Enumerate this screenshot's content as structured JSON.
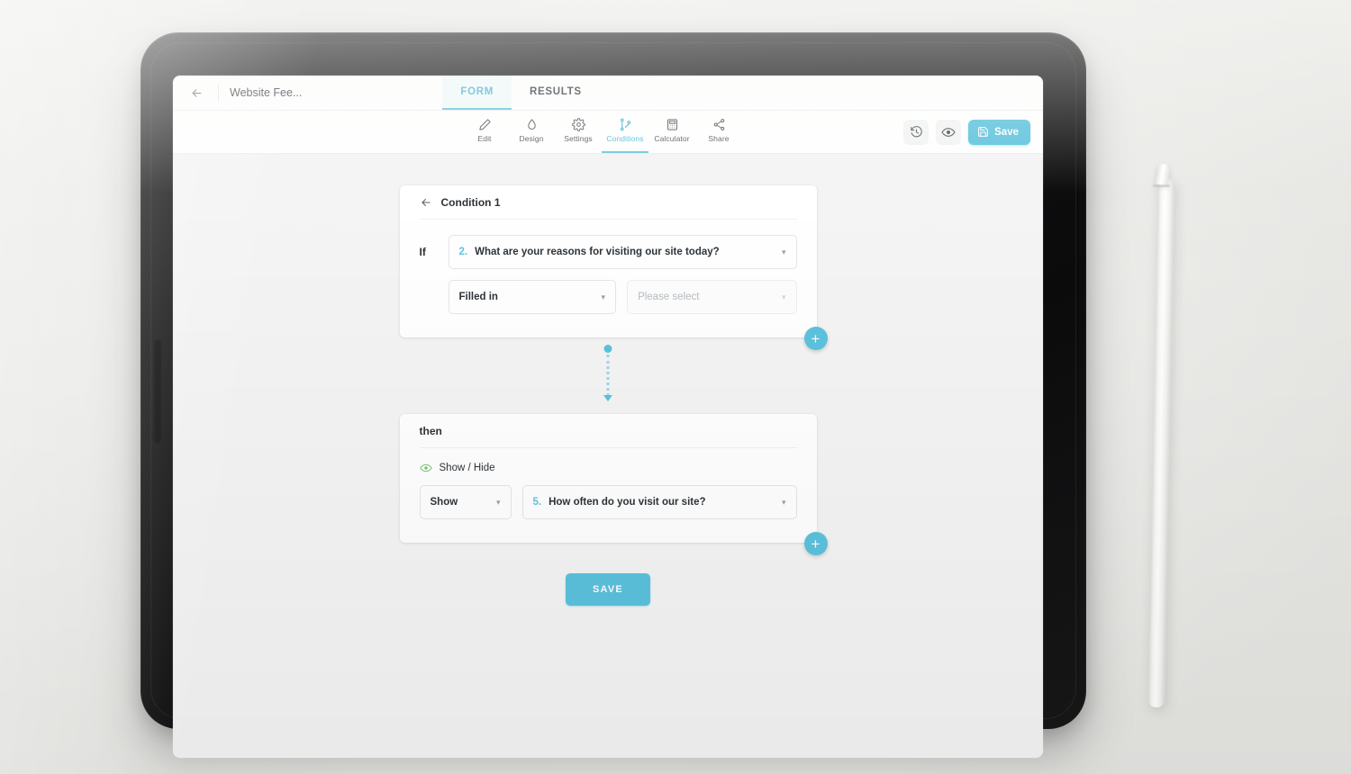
{
  "app": {
    "back_icon": "back-arrow-icon",
    "form_title": "Website Fee...",
    "tabs": [
      {
        "label": "FORM",
        "active": true
      },
      {
        "label": "RESULTS",
        "active": false
      }
    ],
    "tools": [
      {
        "label": "Edit",
        "icon": "pencil-icon",
        "active": false
      },
      {
        "label": "Design",
        "icon": "droplet-icon",
        "active": false
      },
      {
        "label": "Settings",
        "icon": "gear-icon",
        "active": false
      },
      {
        "label": "Conditions",
        "icon": "branch-icon",
        "active": true
      },
      {
        "label": "Calculator",
        "icon": "calculator-icon",
        "active": false
      },
      {
        "label": "Share",
        "icon": "share-nodes-icon",
        "active": false
      }
    ],
    "actions": {
      "history_icon": "history-clock-icon",
      "preview_icon": "eye-icon",
      "save_label": "Save",
      "save_icon": "floppy-disk-icon"
    }
  },
  "condition": {
    "title": "Condition 1",
    "back_icon": "back-arrow-icon",
    "if_label": "If",
    "question": {
      "number": "2.",
      "text": "What are your reasons for visiting our site today?"
    },
    "operator": {
      "value": "Filled in"
    },
    "value_select": {
      "placeholder": "Please select"
    },
    "add_label": "+"
  },
  "then": {
    "title": "then",
    "action_type": "Show / Hide",
    "action_icon": "eye-icon",
    "action": {
      "value": "Show"
    },
    "target": {
      "number": "5.",
      "text": "How often do you visit our site?"
    },
    "add_label": "+"
  },
  "footer": {
    "save_label": "SAVE"
  },
  "colors": {
    "accent": "#5bc2dd",
    "accent_text": "#53b7d4",
    "green": "#7cc576",
    "text": "#2e3439",
    "muted": "#b6bcc1",
    "canvas": "#f4f4f4"
  }
}
